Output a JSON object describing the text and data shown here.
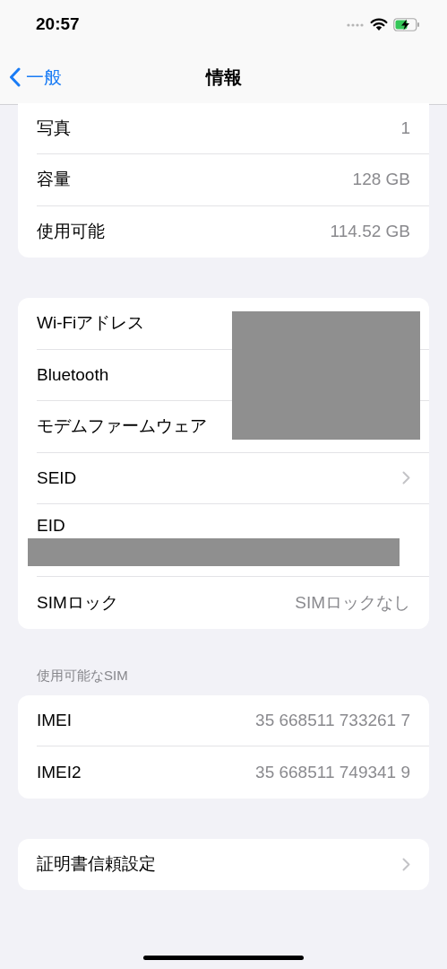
{
  "status_bar": {
    "time": "20:57"
  },
  "nav": {
    "back": "一般",
    "title": "情報"
  },
  "groups": [
    {
      "rows": [
        {
          "kind": "value",
          "label": "写真",
          "value": "1"
        },
        {
          "kind": "value",
          "label": "容量",
          "value": "128 GB"
        },
        {
          "kind": "value",
          "label": "使用可能",
          "value": "114.52 GB"
        }
      ]
    },
    {
      "rows": [
        {
          "kind": "hidden",
          "label": "Wi-Fiアドレス"
        },
        {
          "kind": "hidden",
          "label": "Bluetooth"
        },
        {
          "kind": "hidden",
          "label": "モデムファームウェア"
        },
        {
          "kind": "chevron",
          "label": "SEID"
        },
        {
          "kind": "stacked",
          "label": "EID"
        },
        {
          "kind": "value",
          "label": "SIMロック",
          "value": "SIMロックなし"
        }
      ]
    },
    {
      "header": "使用可能なSIM",
      "rows": [
        {
          "kind": "value",
          "label": "IMEI",
          "value": "35 668511 733261 7"
        },
        {
          "kind": "value",
          "label": "IMEI2",
          "value": "35 668511 749341 9"
        }
      ]
    },
    {
      "rows": [
        {
          "kind": "chevron",
          "label": "証明書信頼設定"
        }
      ]
    }
  ]
}
